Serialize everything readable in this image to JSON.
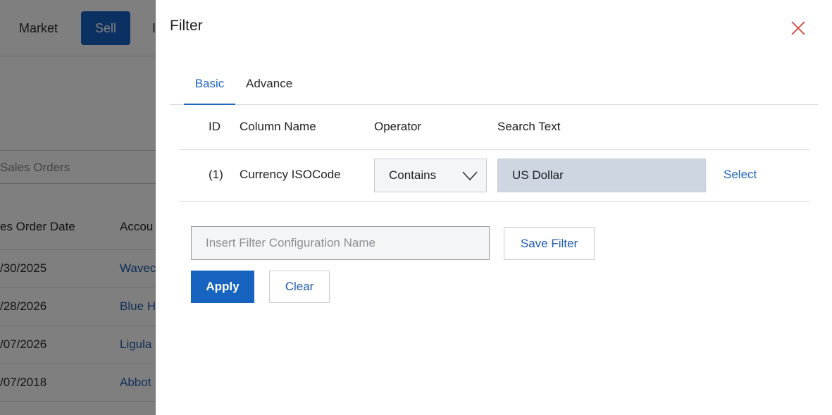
{
  "background": {
    "nav": {
      "market": "Market",
      "sell": "Sell",
      "more": "I"
    },
    "search_placeholder": "Sales Orders",
    "columns": [
      "es Order Date",
      "Accou"
    ],
    "rows": [
      {
        "date": "/30/2025",
        "account": "Wavec"
      },
      {
        "date": "/28/2026",
        "account": "Blue H"
      },
      {
        "date": "/07/2026",
        "account": "Ligula"
      },
      {
        "date": "/07/2018",
        "account": "Abbot"
      }
    ]
  },
  "filter": {
    "title": "Filter",
    "close_icon": "close-icon",
    "tabs": {
      "basic": "Basic",
      "advance": "Advance"
    },
    "active_tab": "Basic",
    "headers": {
      "id": "ID",
      "column_name": "Column Name",
      "operator": "Operator",
      "search_text": "Search Text"
    },
    "row": {
      "id": "(1)",
      "column_name": "Currency ISOCode",
      "operator": "Contains",
      "search_text": "US Dollar",
      "select_label": "Select"
    },
    "config_placeholder": "Insert Filter Configuration Name",
    "config_value": "",
    "save_label": "Save Filter",
    "apply_label": "Apply",
    "clear_label": "Clear"
  },
  "colors": {
    "accent": "#1764c0",
    "link": "#1f66c1",
    "close": "#d0453a",
    "search_fill": "#cdd6e1"
  }
}
